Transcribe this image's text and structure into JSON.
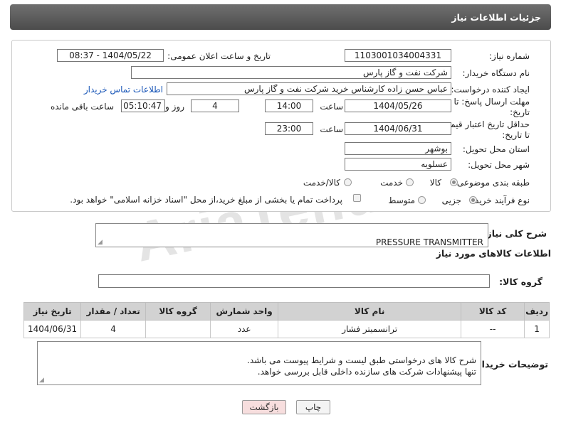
{
  "header": {
    "title": "جزئیات اطلاعات نیاز"
  },
  "watermark": "AriaTender.net",
  "form": {
    "need_number_label": "شماره نیاز:",
    "need_number": "1103001034004331",
    "announce_label": "تاریخ و ساعت اعلان عمومی:",
    "announce_value": "1404/05/22 - 08:37",
    "buyer_org_label": "نام دستگاه خریدار:",
    "buyer_org": "شرکت نفت و گاز پارس",
    "requester_label": "ایجاد کننده درخواست:",
    "requester": "عباس حسن زاده کارشناس خرید شرکت نفت و گاز پارس",
    "contact_link": "اطلاعات تماس خریدار",
    "deadline_label_1": "مهلت ارسال پاسخ: تا",
    "deadline_label_2": "تاریخ:",
    "deadline_date": "1404/05/26",
    "time_label": "ساعت",
    "deadline_time": "14:00",
    "days_value": "4",
    "days_label": "روز و",
    "remaining_time": "05:10:47",
    "remaining_label": "ساعت باقی مانده",
    "price_validity_label_1": "حداقل تاریخ اعتبار قیمت:",
    "price_validity_label_2": "تا تاریخ:",
    "price_date": "1404/06/31",
    "price_time": "23:00",
    "province_label": "استان محل تحویل:",
    "province": "بوشهر",
    "city_label": "شهر محل تحویل:",
    "city": "عسلویه",
    "category_label": "طبقه بندی موضوعی:",
    "category_options": [
      "کالا",
      "خدمت",
      "کالا/خدمت"
    ],
    "category_selected": "کالا",
    "process_label": "نوع فرآیند خرید :",
    "process_options": [
      "جزیی",
      "متوسط"
    ],
    "process_selected": "جزیی",
    "payment_note": "پرداخت تمام یا بخشی از مبلغ خرید،از محل \"اسناد خزانه اسلامی\" خواهد بود."
  },
  "summary": {
    "label": "شرح کلی نیاز:",
    "value": "PRESSURE TRANSMITTER"
  },
  "items_section": {
    "title": "اطلاعات کالاهای مورد نیاز",
    "group_label": "گروه کالا:",
    "group_value": "",
    "columns": [
      "ردیف",
      "کد کالا",
      "نام کالا",
      "واحد شمارش",
      "گروه کالا",
      "تعداد / مقدار",
      "تاریخ نیاز"
    ],
    "rows": [
      {
        "row": "1",
        "code": "--",
        "name": "ترانسمیتر فشار",
        "unit": "عدد",
        "group": "",
        "qty": "4",
        "date": "1404/06/31"
      }
    ]
  },
  "buyer_notes": {
    "label": "توضیحات خریدار:",
    "text": "شرح کالا های درخواستی طبق لیست و شرایط پیوست می باشد.\nتنها پیشنهادات شرکت های سازنده داخلی قابل بررسی خواهد."
  },
  "buttons": {
    "print": "چاپ",
    "back": "بازگشت"
  },
  "colors": {
    "header_bg": "#5c5c5c",
    "link": "#1a57b8",
    "back_bg": "#f7dede",
    "table_head": "#d2d2d2"
  }
}
